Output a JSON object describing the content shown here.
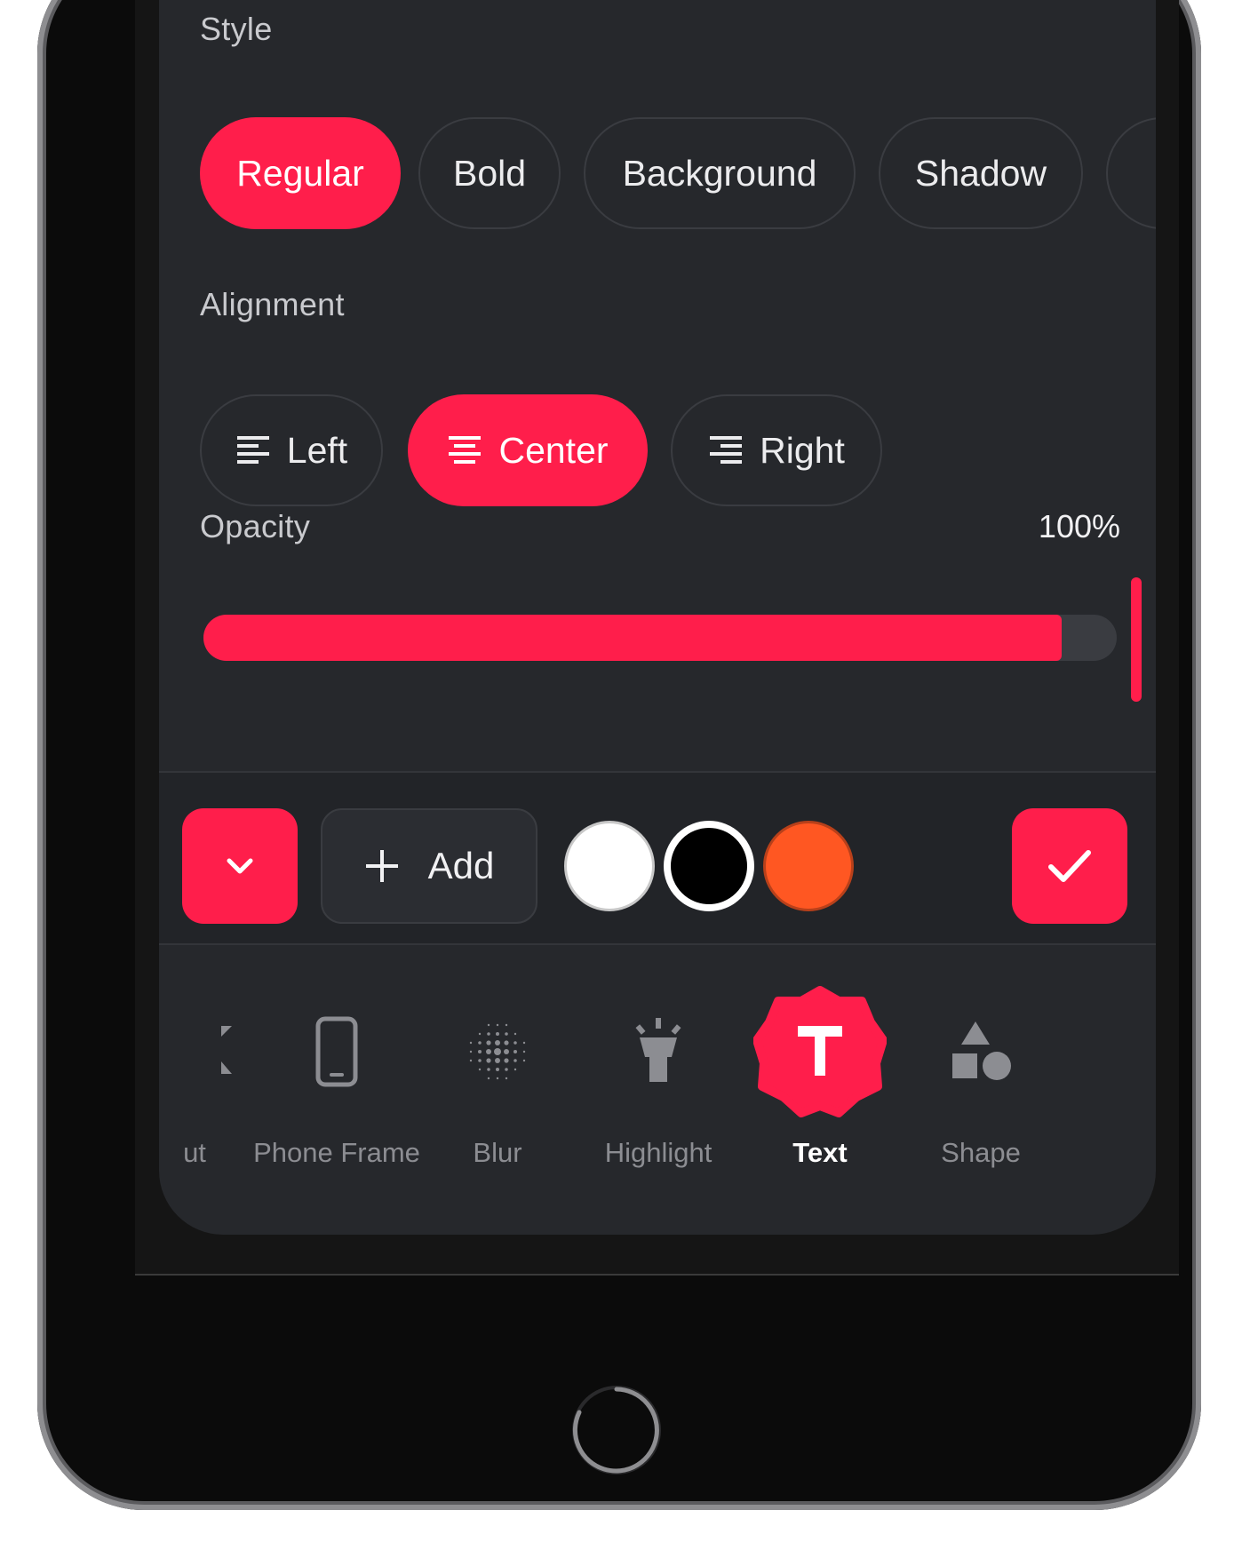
{
  "style": {
    "label": "Style",
    "options": [
      "Regular",
      "Bold",
      "Background",
      "Shadow"
    ],
    "selected": "Regular"
  },
  "alignment": {
    "label": "Alignment",
    "options": [
      "Left",
      "Center",
      "Right"
    ],
    "selected": "Center"
  },
  "opacity": {
    "label": "Opacity",
    "value_text": "100%",
    "value": 1.0
  },
  "toolbar": {
    "collapse_icon": "chevron-down-icon",
    "add_label": "Add",
    "confirm_icon": "checkmark-icon",
    "swatches": [
      "#ffffff",
      "#000000",
      "#ff5722"
    ]
  },
  "nav": {
    "items": [
      "ut",
      "Phone Frame",
      "Blur",
      "Highlight",
      "Text",
      "Shape"
    ],
    "active": "Text"
  },
  "colors": {
    "accent": "#ff1e4b",
    "panel": "#26282c"
  }
}
